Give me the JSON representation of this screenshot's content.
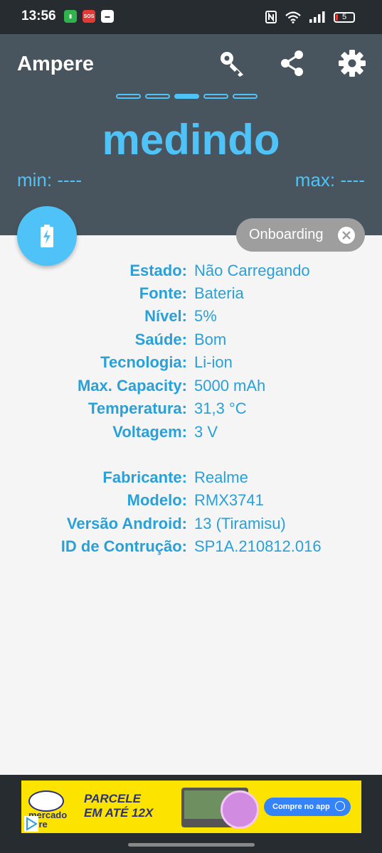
{
  "status_bar": {
    "time": "13:56",
    "notif_labels": [
      "",
      "SOS",
      ""
    ],
    "battery_level": "5"
  },
  "header": {
    "title": "Ampere",
    "icons": [
      "key-icon",
      "share-icon",
      "settings-icon"
    ],
    "page_dots": 5,
    "active_dot": 2,
    "headline": "medindo",
    "min_label": "min: ----",
    "max_label": "max: ----"
  },
  "fab": {
    "icon": "battery-charging-icon"
  },
  "chip": {
    "label": "Onboarding"
  },
  "battery_info": [
    {
      "key": "Estado:",
      "value": "Não Carregando"
    },
    {
      "key": "Fonte:",
      "value": "Bateria"
    },
    {
      "key": "Nível:",
      "value": "5%"
    },
    {
      "key": "Saúde:",
      "value": "Bom"
    },
    {
      "key": "Tecnologia:",
      "value": "Li-ion"
    },
    {
      "key": "Max. Capacity:",
      "value": "5000 mAh"
    },
    {
      "key": "Temperatura:",
      "value": "31,3 °C"
    },
    {
      "key": "Voltagem:",
      "value": "3 V"
    }
  ],
  "device_info": [
    {
      "key": "Fabricante:",
      "value": "Realme"
    },
    {
      "key": "Modelo:",
      "value": "RMX3741"
    },
    {
      "key": "Versão Android:",
      "value": "13 (Tiramisu)"
    },
    {
      "key": "ID de Contrução:",
      "value": "SP1A.210812.016"
    }
  ],
  "ad": {
    "brand_line1": "mercado",
    "brand_line2": "livre",
    "headline_line1": "PARCELE",
    "headline_line2": "EM ATÉ 12X",
    "cta": "Compre no app"
  },
  "colors": {
    "header_bg": "#48555e",
    "accent": "#4fc3f7",
    "label": "#29a0d8",
    "ad_bg": "#fce400"
  }
}
